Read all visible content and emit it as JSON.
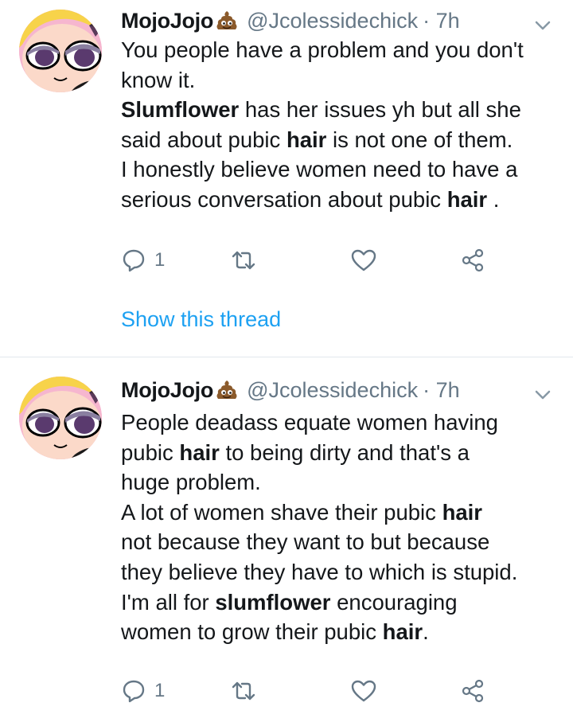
{
  "colors": {
    "text": "#14171a",
    "secondary": "#657786",
    "link": "#1da1f2",
    "divider": "#e1e8ed",
    "avatar_bg": "#f6b6cf"
  },
  "tweets": [
    {
      "display_name": "MojoJojo",
      "name_emoji": "pile-of-poo-emoji",
      "handle": "@Jcolessidechick",
      "time": "· 7h",
      "lines": [
        [
          {
            "t": "You people have a problem and you don't",
            "b": false
          }
        ],
        [
          {
            "t": "know it.",
            "b": false
          }
        ],
        [
          {
            "t": "Slumflower",
            "b": true
          },
          {
            "t": " has her issues yh but all she",
            "b": false
          }
        ],
        [
          {
            "t": "said about pubic ",
            "b": false
          },
          {
            "t": "hair",
            "b": true
          },
          {
            "t": " is not one of them.",
            "b": false
          }
        ],
        [
          {
            "t": "I honestly believe women need to have a",
            "b": false
          }
        ],
        [
          {
            "t": "serious conversation about pubic ",
            "b": false
          },
          {
            "t": "hair",
            "b": true
          },
          {
            "t": " .",
            "b": false
          }
        ]
      ],
      "reply_count": "1",
      "show_thread": "Show this thread"
    },
    {
      "display_name": "MojoJojo",
      "name_emoji": "pile-of-poo-emoji",
      "handle": "@Jcolessidechick",
      "time": "· 7h",
      "lines": [
        [
          {
            "t": "People deadass equate women having",
            "b": false
          }
        ],
        [
          {
            "t": "pubic ",
            "b": false
          },
          {
            "t": "hair",
            "b": true
          },
          {
            "t": " to being dirty and that's a",
            "b": false
          }
        ],
        [
          {
            "t": "huge problem.",
            "b": false
          }
        ],
        [
          {
            "t": "A lot of women shave their pubic ",
            "b": false
          },
          {
            "t": "hair",
            "b": true
          }
        ],
        [
          {
            "t": "not because they want to but because",
            "b": false
          }
        ],
        [
          {
            "t": "they believe they have to which is stupid.",
            "b": false
          }
        ],
        [
          {
            "t": "I'm all for ",
            "b": false
          },
          {
            "t": "slumflower",
            "b": true
          },
          {
            "t": " encouraging",
            "b": false
          }
        ],
        [
          {
            "t": "women to grow their pubic ",
            "b": false
          },
          {
            "t": "hair",
            "b": true
          },
          {
            "t": ".",
            "b": false
          }
        ]
      ],
      "reply_count": "1"
    }
  ],
  "icons": {
    "reply": "speech-bubble-icon",
    "retweet": "retweet-icon",
    "like": "heart-icon",
    "share": "share-icon",
    "menu": "chevron-down-icon",
    "avatar": "cartoon-girl-avatar"
  }
}
